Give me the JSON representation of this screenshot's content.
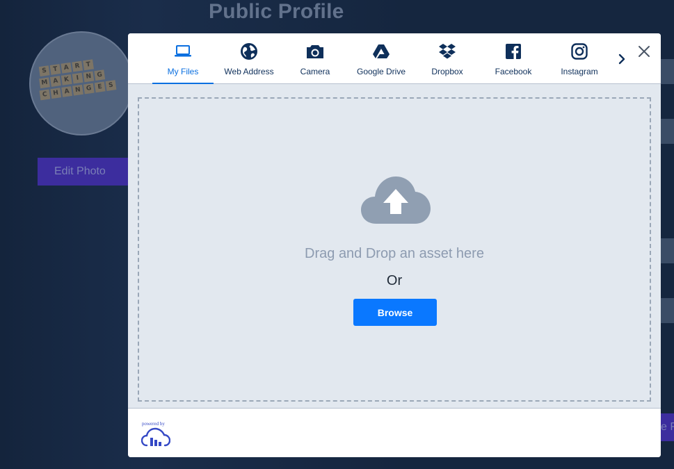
{
  "page": {
    "title": "Public Profile",
    "edit_photo_label": "Edit Photo",
    "right_button_label": "e F",
    "avatar_tiles": [
      [
        "S",
        "T",
        "A",
        "R",
        "T"
      ],
      [
        "M",
        "A",
        "K",
        "I",
        "N",
        "G"
      ],
      [
        "C",
        "H",
        "A",
        "N",
        "G",
        "E",
        "S"
      ]
    ]
  },
  "modal": {
    "tabs": [
      {
        "label": "My Files",
        "icon": "laptop-icon",
        "active": true
      },
      {
        "label": "Web Address",
        "icon": "globe-icon",
        "active": false
      },
      {
        "label": "Camera",
        "icon": "camera-icon",
        "active": false
      },
      {
        "label": "Google Drive",
        "icon": "google-drive-icon",
        "active": false
      },
      {
        "label": "Dropbox",
        "icon": "dropbox-icon",
        "active": false
      },
      {
        "label": "Facebook",
        "icon": "facebook-icon",
        "active": false
      },
      {
        "label": "Instagram",
        "icon": "instagram-icon",
        "active": false
      }
    ],
    "dropzone": {
      "drag_text": "Drag and Drop an asset here",
      "or_text": "Or",
      "browse_label": "Browse"
    },
    "footer": {
      "powered_by": "powered by"
    }
  },
  "colors": {
    "accent": "#0a78ff",
    "tab_text": "#0e2f5a",
    "active_tab": "#0a6fe0",
    "dropzone_bg": "#e2e8ef",
    "backdrop": "#15263f",
    "edit_button": "#3c2d9e",
    "brand_logo": "#3448c5"
  }
}
